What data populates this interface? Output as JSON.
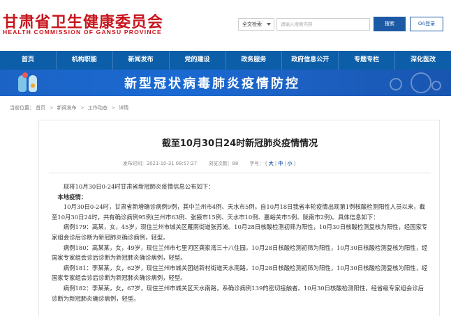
{
  "site": {
    "name_cn": "甘肃省卫生健康委员会",
    "name_en": "HEALTH COMMISSION OF GANSU PROVINCE"
  },
  "search": {
    "scope": "全文检索",
    "placeholder": "请输入搜索内容",
    "button": "搜索",
    "oa_login": "OA登录"
  },
  "nav": {
    "items": [
      "首页",
      "机构职能",
      "新闻发布",
      "党的建设",
      "政务服务",
      "政府信息公开",
      "专题专栏",
      "深化医改"
    ]
  },
  "banner": {
    "title": "新型冠状病毒肺炎疫情防控"
  },
  "breadcrumb": {
    "label": "当前位置：",
    "items": [
      "首页",
      "新闻发布",
      "工作动态",
      "详情"
    ]
  },
  "article": {
    "title": "截至10月30日24时新冠肺炎疫情情况",
    "meta": {
      "published_label": "发布时间：",
      "published": "2021-10-31 08:57:27",
      "views_label": "浏览次数：",
      "views": "88",
      "size_label": "字号：",
      "size_large": "大",
      "size_medium": "中",
      "size_small": "小"
    },
    "paragraphs": [
      "现将10月30日0-24时甘肃省新冠肺炎疫情信息公布如下：",
      "本地疫情：",
      "10月30日0-24时，甘肃省新增确诊病例9例，其中兰州市4例、天水市5例。自10月18日我省本轮疫情出现第1例核酸检测阳性人员以来，截至10月30日24时，共有确诊病例95例(兰州市63例、张掖市15例、天水市10例、嘉峪关市5例、陇南市2例)。具体信息如下：",
      "病例179：高某，女，45岁，现住兰州市城关区雁南街道张苏滩。10月28日核酸检测初筛为阳性，10月30日核酸检测复核为阳性，经国家专家组会诊后诊断为新冠肺炎确诊病例，轻型。",
      "病例180：高某某，女，49岁，现住兰州市七里河区龚家湾三十八住园。10月28日核酸检测初筛为阳性，10月30日核酸检测复核为阳性，经国家专家组会诊后诊断为新冠肺炎确诊病例，轻型。",
      "病例181：李某某，女，62岁，现住兰州市城关团结新村街道天水南路。10月28日核酸检测初筛为阳性，10月30日核酸检测复核为阳性，经国家专家组会诊后诊断为新冠肺炎确诊病例，轻型。",
      "病例182：李某某，女，67岁，现住兰州市城关区天水南路，系确诊病例139的密切接触者。10月30日核酸检测阳性，经省级专家组会诊后诊断为新冠肺炎确诊病例，轻型。"
    ]
  },
  "colors": {
    "brand_red": "#c8161d",
    "nav_blue": "#0d5ea8",
    "button_blue": "#1c5aa5",
    "banner_blue": "#1a6ad2"
  }
}
